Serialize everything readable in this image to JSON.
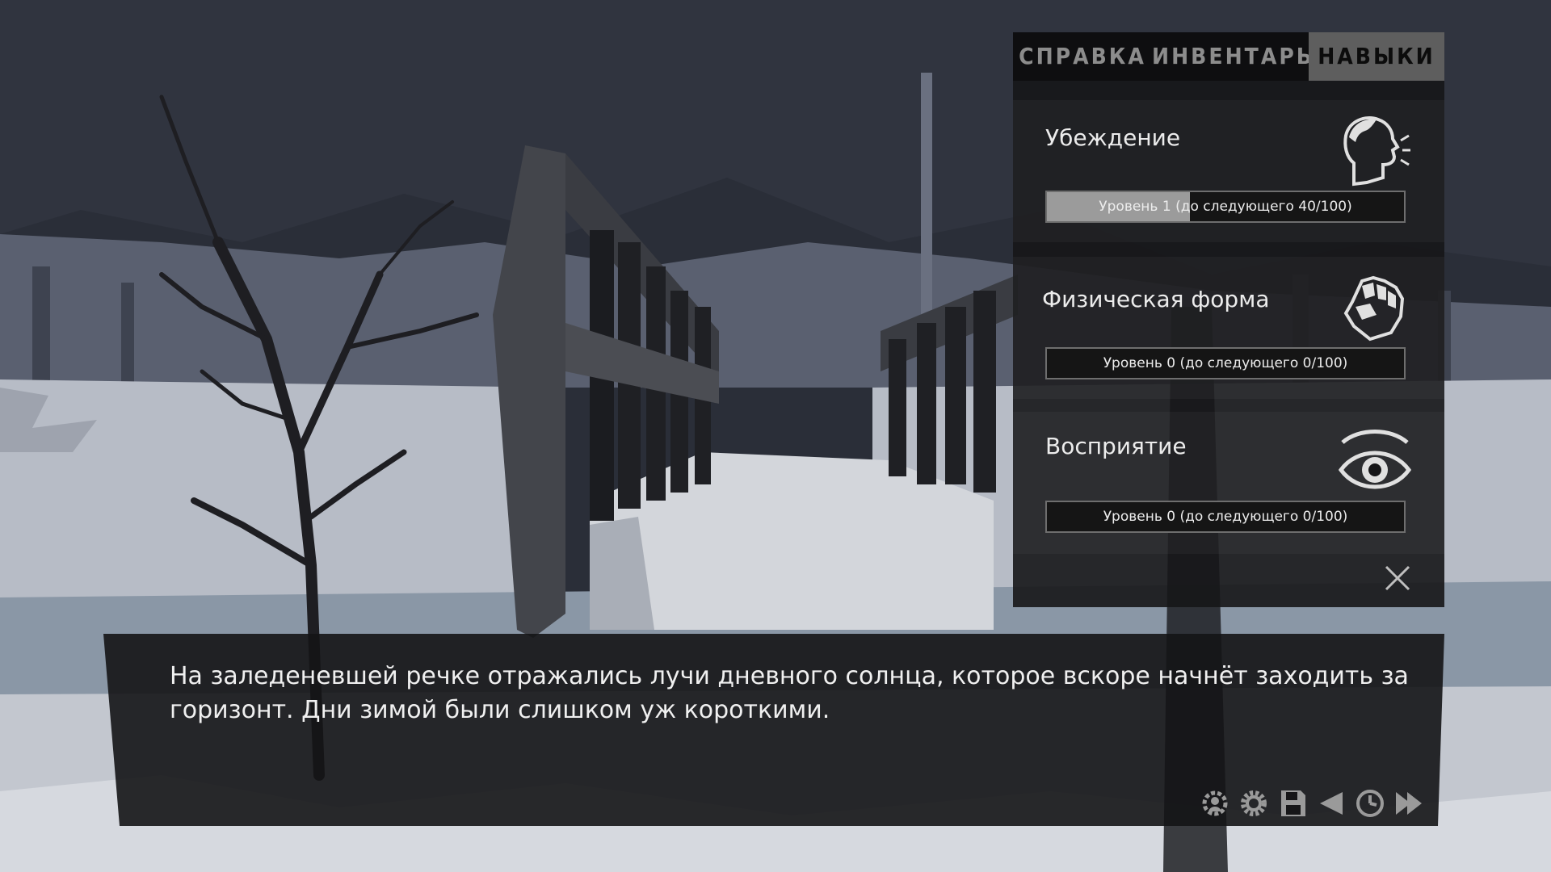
{
  "tabs": [
    {
      "label": "СПРАВКА",
      "active": false
    },
    {
      "label": "ИНВЕНТАРЬ",
      "active": false
    },
    {
      "label": "НАВЫКИ",
      "active": true
    }
  ],
  "skills": [
    {
      "name": "Убеждение",
      "icon": "speaking-head-icon",
      "level_text": "Уровень 1 (до следующего 40/100)",
      "progress": 0.4
    },
    {
      "name": "Физическая форма",
      "icon": "fist-icon",
      "level_text": "Уровень 0 (до следующего 0/100)",
      "progress": 0
    },
    {
      "name": "Восприятие",
      "icon": "eye-icon",
      "level_text": "Уровень 0 (до следующего 0/100)",
      "progress": 0
    }
  ],
  "dialog": {
    "text": "На заледеневшей речке отражались лучи дневного солнца, которое вскоре начнёт заходить за горизонт. Дни зимой были слишком уж короткими."
  },
  "quick_menu": [
    "achievements-icon",
    "settings-icon",
    "save-icon",
    "back-icon",
    "history-icon",
    "skip-icon"
  ],
  "colors": {
    "panel_bg": "#161618",
    "tab_active": "#5e5e5e",
    "bar_fill": "#9b9b9b",
    "snow": "#c8ccd4",
    "sky": "#2a2e38"
  }
}
